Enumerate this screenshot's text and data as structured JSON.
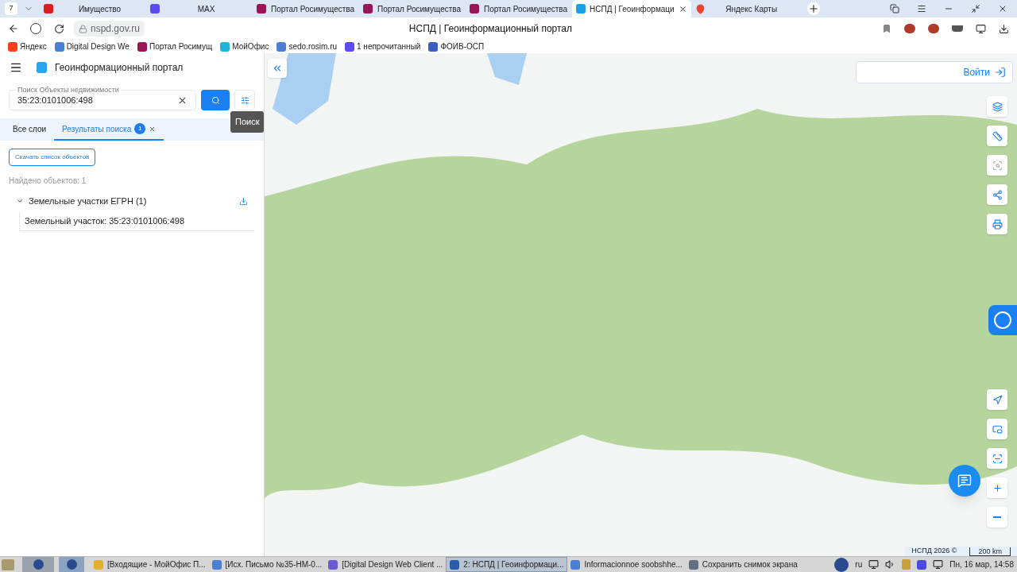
{
  "browser": {
    "tab_count": "7",
    "tabs": [
      {
        "title": "Имущество",
        "selected": false,
        "kind": "rts"
      },
      {
        "title": "MAX",
        "selected": false,
        "kind": "max"
      },
      {
        "title": "Портал Росимущества",
        "selected": false,
        "kind": "rosim"
      },
      {
        "title": "Портал Росимущества",
        "selected": false,
        "kind": "rosim"
      },
      {
        "title": "Портал Росимущества",
        "selected": false,
        "kind": "rosim"
      },
      {
        "title": "НСПД | Геоинформаци",
        "selected": true,
        "kind": "nspd"
      },
      {
        "title": "Яндекс Карты",
        "selected": false,
        "kind": "maps"
      }
    ],
    "address": "nspd.gov.ru",
    "page_title": "НСПД | Геоинформационный портал",
    "bookmarks": [
      {
        "title": "Яндекс",
        "kind": "ya"
      },
      {
        "title": "Digital Design We",
        "kind": "doc"
      },
      {
        "title": "Портал Росимущ",
        "kind": "rosim"
      },
      {
        "title": "МойОфис",
        "kind": "office"
      },
      {
        "title": "sedo.rosim.ru",
        "kind": "doc"
      },
      {
        "title": "1 непрочитанный",
        "kind": "max"
      },
      {
        "title": "ФОИВ-ОСП",
        "kind": "crest"
      }
    ]
  },
  "sidebar": {
    "title": "Геоинформационный портал",
    "search": {
      "label": "Поиск Объекты недвижимости",
      "value": "35:23:0101006:498"
    },
    "tooltip": "Поиск",
    "tabs": [
      {
        "label": "Все слои",
        "selected": false
      },
      {
        "label": "Результаты поиска",
        "selected": true,
        "badge": "1"
      }
    ],
    "download_button": "Скачать список объектов",
    "found": "Найдено объектов: 1",
    "groups": [
      {
        "title": "Земельные участки ЕГРН (1)",
        "expanded": true,
        "items": [
          "Земельный участок: 35:23:0101006:498"
        ]
      }
    ]
  },
  "map": {
    "login": "Войти",
    "attribution": "НСПД 2026 ©",
    "scale": "200 km"
  },
  "taskbar": {
    "items": [
      {
        "label": "[Входящие - МойОфис П...",
        "selected": false,
        "kind": "mail"
      },
      {
        "label": "[Исх. Письмо №35-НМ-0...",
        "selected": false,
        "kind": "doc"
      },
      {
        "label": "[Digital Design Web Client ...",
        "selected": false,
        "kind": "web"
      },
      {
        "label": "2: НСПД | Геоинформаци...",
        "selected": true,
        "kind": "browser"
      },
      {
        "label": "Informacionnoe soobshhe...",
        "selected": false,
        "kind": "doc"
      },
      {
        "label": "Сохранить снимок экрана",
        "selected": false,
        "kind": "shot"
      }
    ],
    "lang": "ru",
    "clock": "Пн, 16 мар, 14:58"
  }
}
